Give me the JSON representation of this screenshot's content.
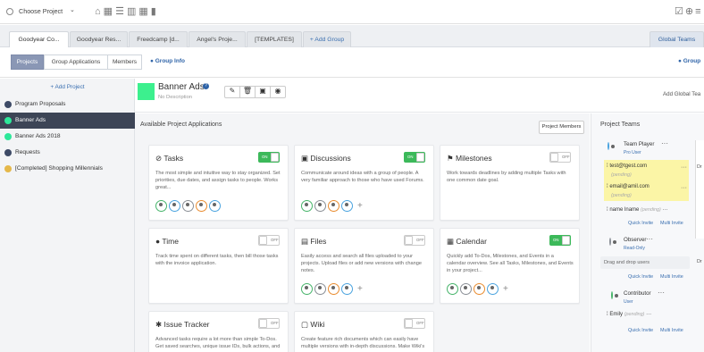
{
  "topbar": {
    "choose_project": "Choose Project"
  },
  "tabs": [
    "Goodyear Co...",
    "Goodyear Res...",
    "Freedcamp [d...",
    "Angel's Proje...",
    "[TEMPLATES]"
  ],
  "add_group": "+ Add Group",
  "global_teams": "Global Teams",
  "subtabs": {
    "projects": "Projects",
    "group_applications": "Group Applications",
    "members": "Members"
  },
  "group_info": "Group Info",
  "group_right": "Group",
  "sidebar": {
    "add_project": "+ Add Project",
    "projects": [
      {
        "name": "Program Proposals",
        "color": "#3d4a66"
      },
      {
        "name": "Banner Ads",
        "color": "#2ee89a"
      },
      {
        "name": "Banner Ads 2018",
        "color": "#2ee89a"
      },
      {
        "name": "Requests",
        "color": "#3d4a66"
      },
      {
        "name": "[Completed] Shopping Millennials",
        "color": "#e5b84a"
      }
    ]
  },
  "project": {
    "name": "Banner Ads",
    "description": "No Description",
    "color": "#3cf08e"
  },
  "add_global_team": "Add Global Tea",
  "apps_heading": "Available Project Applications",
  "project_members_btn": "Project Members",
  "apps": [
    {
      "title": "Tasks",
      "desc": "The most simple and intuitive way to stay organized. Set priorities, due dates, and assign tasks to people. Works great...",
      "toggle": "ON"
    },
    {
      "title": "Discussions",
      "desc": "Communicate around ideas with a group of people. A very familiar approach to those who have used Forums.",
      "toggle": "ON"
    },
    {
      "title": "Milestones",
      "desc": "Work towards deadlines by adding multiple Tasks with one common date goal.",
      "toggle": "OFF"
    },
    {
      "title": "Time",
      "desc": "Track time spent on different tasks, then bill those tasks with the invoice application.",
      "toggle": "OFF"
    },
    {
      "title": "Files",
      "desc": "Easily access and search all files uploaded to your projects. Upload files or add new versions with change notes.",
      "toggle": "OFF"
    },
    {
      "title": "Calendar",
      "desc": "Quickly add To-Dos, Milestones, and Events in a calendar overview. See all Tasks, Milestones, and Events in your project...",
      "toggle": "ON"
    },
    {
      "title": "Issue Tracker",
      "desc": "Advanced tasks require a lot more than simple To-Dos. Get saved searches, unique issue IDs, bulk actions, and",
      "toggle": "OFF"
    },
    {
      "title": "Wiki",
      "desc": "Create feature rich documents which can easily have multiple versions with in-depth discussions. Make Wiki's",
      "toggle": "OFF"
    }
  ],
  "teams": {
    "heading": "Project Teams",
    "player": {
      "title": "Team Player",
      "role": "Pro User",
      "email1": "test@tgest.com",
      "pending1": "(pending)",
      "email2": "email@amil.com",
      "pending2": "(pending)",
      "name": "name lname",
      "pending3": "(pending)"
    },
    "observer": {
      "title": "Observer",
      "role": "Read-Only",
      "drop": "Drag and drop users"
    },
    "contributor": {
      "title": "Contributor",
      "role": "User",
      "name": "Emily",
      "pending": "(pending)"
    },
    "quick_invite": "Quick Invite",
    "multi_invite": "Multi Invite",
    "dr": "Dr"
  }
}
